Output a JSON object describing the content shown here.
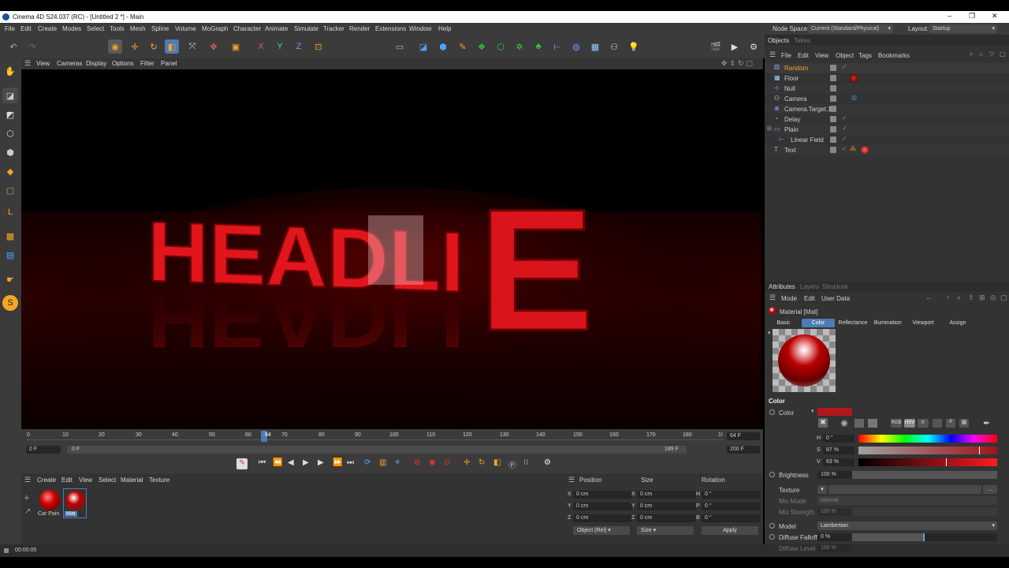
{
  "window": {
    "title": "Cinema 4D S24.037 (RC) - [Untitled 2 *] - Main",
    "buttons": [
      "–",
      "❐",
      "✕"
    ]
  },
  "menu": [
    "File",
    "Edit",
    "Create",
    "Modes",
    "Select",
    "Tools",
    "Mesh",
    "Spline",
    "Volume",
    "MoGraph",
    "Character",
    "Animate",
    "Simulate",
    "Tracker",
    "Render",
    "Extensions",
    "Window",
    "Help"
  ],
  "nodespace": {
    "label": "Node Space:",
    "value": "Current (Standard/Physical)"
  },
  "layout": {
    "label": "Layout:",
    "value": "Startup"
  },
  "viewport_menu": [
    "View",
    "Cameras",
    "Display",
    "Options",
    "Filter",
    "Panel"
  ],
  "scene": {
    "text": "HEADLI",
    "last_letter": "E",
    "color": "#e0161c"
  },
  "timeline": {
    "ticks": [
      "0",
      "10",
      "20",
      "30",
      "40",
      "50",
      "60",
      "64",
      "70",
      "80",
      "90",
      "100",
      "110",
      "120",
      "130",
      "140",
      "150",
      "160",
      "170",
      "180",
      "1!"
    ],
    "current_frame": "64 F",
    "start": "0 F",
    "range_start": "0 F",
    "range_end": "189 F",
    "end": "200 F"
  },
  "materials": {
    "menu": [
      "Create",
      "Edit",
      "View",
      "Select",
      "Material",
      "Texture"
    ],
    "items": [
      {
        "name": "Car Pain"
      },
      {
        "name": "Mat"
      }
    ]
  },
  "coords": {
    "headers": [
      "Position",
      "Size",
      "Rotation"
    ],
    "rows": [
      {
        "axis": "X",
        "pos": "0 cm",
        "saxis": "X",
        "size": "0 cm",
        "raxis": "H",
        "rot": "0 °"
      },
      {
        "axis": "Y",
        "pos": "0 cm",
        "saxis": "Y",
        "size": "0 cm",
        "raxis": "P",
        "rot": "0 °"
      },
      {
        "axis": "Z",
        "pos": "0 cm",
        "saxis": "Z",
        "size": "0 cm",
        "raxis": "B",
        "rot": "0 °"
      }
    ],
    "mode": "Object (Rel)",
    "size_mode": "Size",
    "apply": "Apply"
  },
  "status": {
    "time": "00:00:05"
  },
  "objects": {
    "tabs": [
      "Objects",
      "Takes"
    ],
    "menu": [
      "File",
      "Edit",
      "View",
      "Object",
      "Tags",
      "Bookmarks"
    ],
    "items": [
      {
        "name": "Random",
        "indent": 0,
        "highlight": true
      },
      {
        "name": "Floor",
        "indent": 0,
        "highlight": false
      },
      {
        "name": "Null",
        "indent": 0,
        "highlight": false
      },
      {
        "name": "Camera",
        "indent": 0,
        "highlight": false
      },
      {
        "name": "Camera.Target.1",
        "indent": 0,
        "highlight": false
      },
      {
        "name": "Delay",
        "indent": 0,
        "highlight": false
      },
      {
        "name": "Plain",
        "indent": 0,
        "highlight": false
      },
      {
        "name": "Linear Field",
        "indent": 1,
        "highlight": false
      },
      {
        "name": "Text",
        "indent": 0,
        "highlight": false
      }
    ]
  },
  "attributes": {
    "tabs": [
      "Attributes",
      "Layers",
      "Structure"
    ],
    "menu": [
      "Mode",
      "Edit",
      "User Data"
    ],
    "title": "Material [Mat]",
    "subtabs": [
      "Basic",
      "Color",
      "Reflectance",
      "Illumination",
      "Viewport",
      "Assign"
    ],
    "section": "Color",
    "color_label": "Color",
    "swatch": "#b3161c",
    "color_modes": [
      "RGB",
      "HSV",
      "K"
    ],
    "h": {
      "label": "H",
      "value": "0 °"
    },
    "s": {
      "label": "S",
      "value": "87 %",
      "fraction": 0.87
    },
    "v": {
      "label": "V",
      "value": "63 %",
      "fraction": 0.63
    },
    "brightness": {
      "label": "Brightness",
      "value": "100 %",
      "fraction": 1.0
    },
    "texture": {
      "label": "Texture",
      "more": "..."
    },
    "mix_mode": {
      "label": "Mix Mode",
      "value": "Normal"
    },
    "mix_strength": {
      "label": "Mix Strength",
      "value": "100 %"
    },
    "model": {
      "label": "Model",
      "value": "Lambertian"
    },
    "diffuse_falloff": {
      "label": "Diffuse Falloff",
      "value": "0 %",
      "fraction": 0.5
    },
    "diffuse_level": {
      "label": "Diffuse Level",
      "value": "100 %"
    }
  }
}
